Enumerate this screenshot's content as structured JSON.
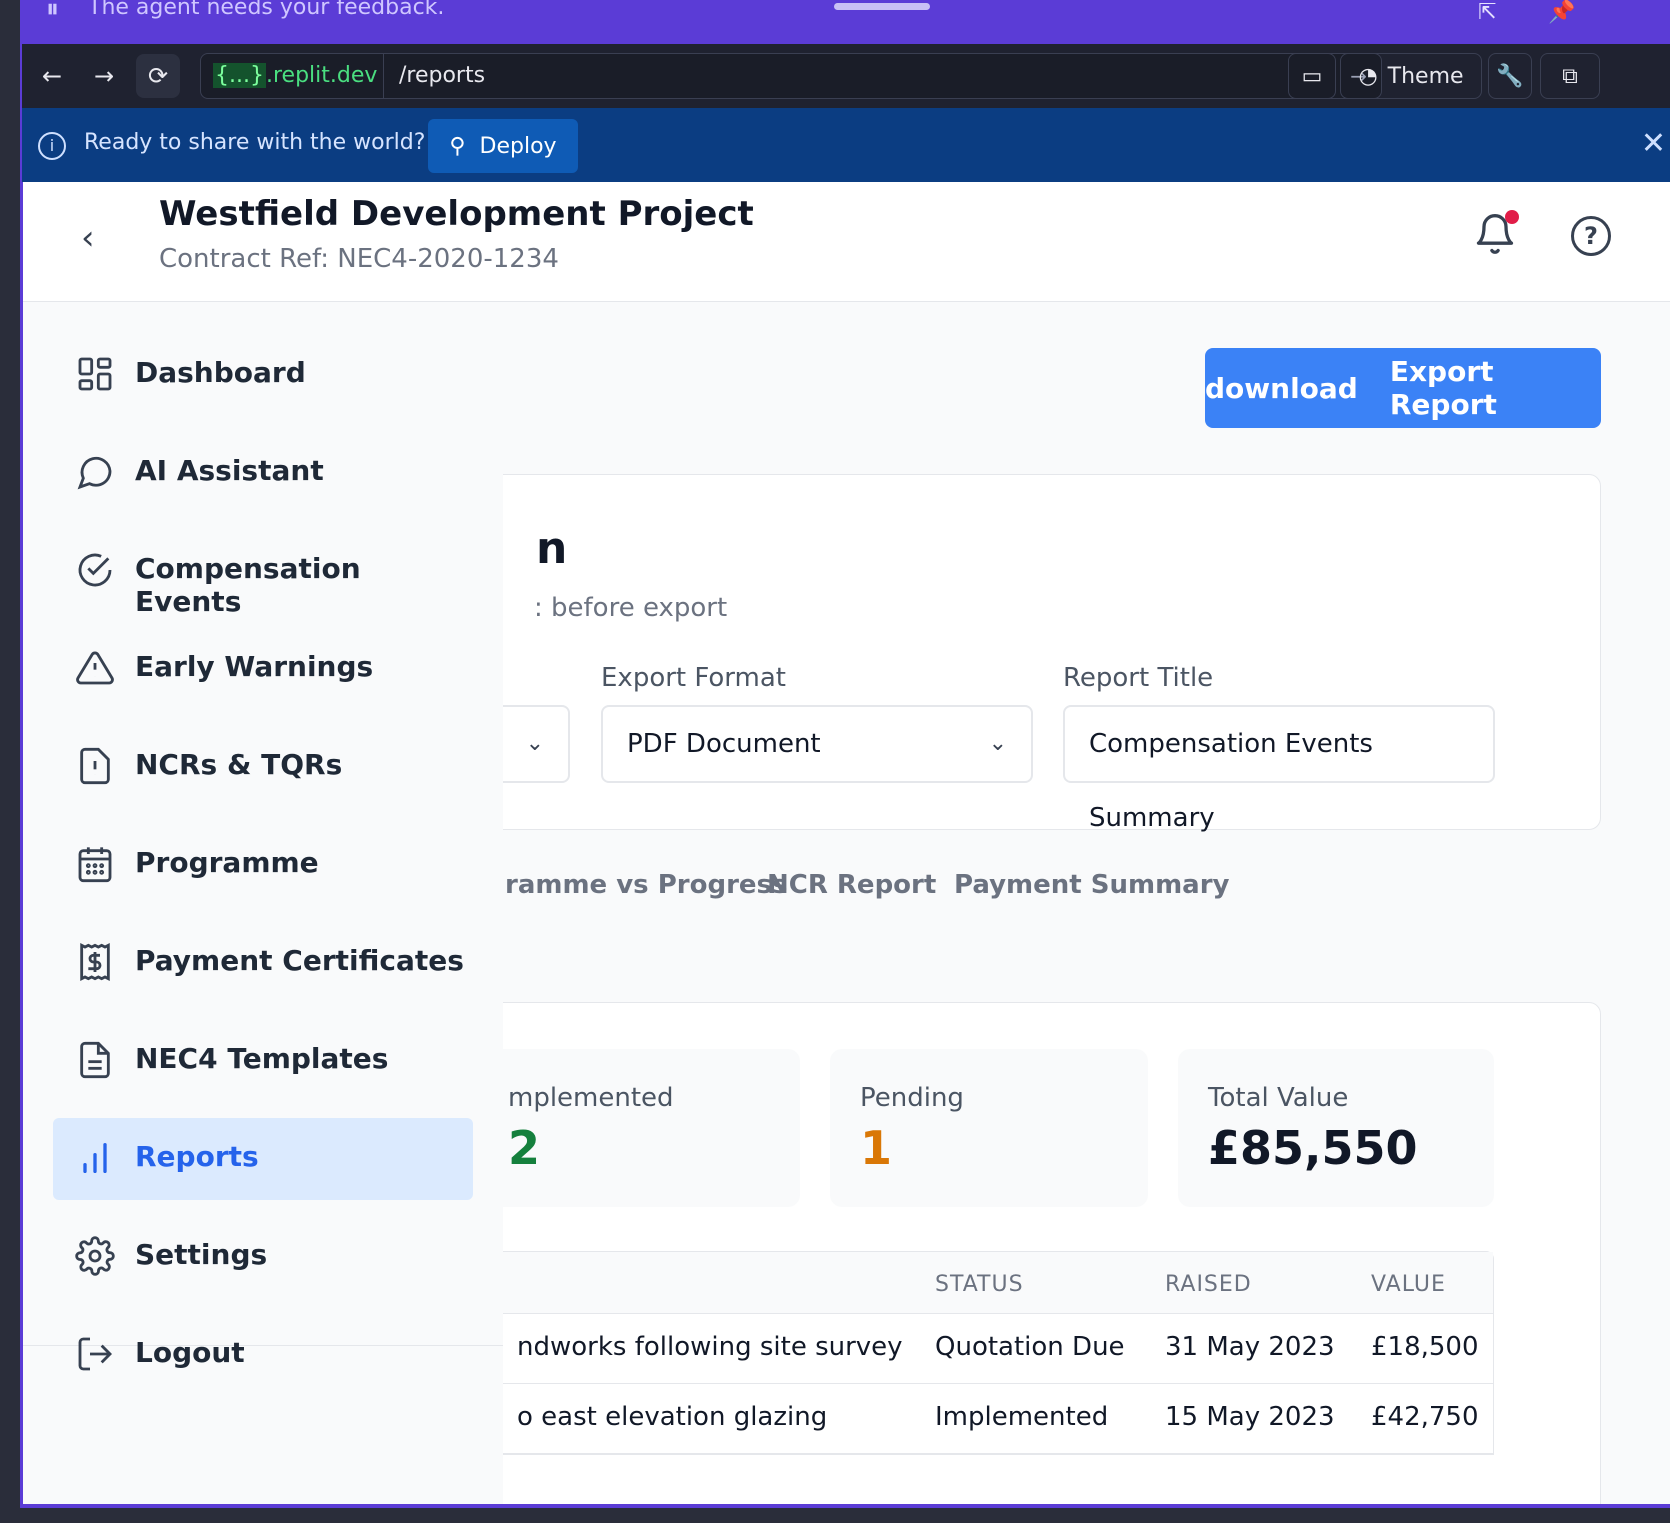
{
  "agent_bar": {
    "message": "The agent needs your feedback."
  },
  "browser": {
    "host_brace": "{...}",
    "host_domain": ".replit.dev",
    "path": "/reports",
    "theme_label": "Theme"
  },
  "deploy_banner": {
    "text": "Ready to share with the world?",
    "button_label": "Deploy"
  },
  "header": {
    "title": "Westfield Development Project",
    "contract_ref": "Contract Ref: NEC4-2020-1234"
  },
  "export_button": {
    "icon_text": "download",
    "label": "Export Report"
  },
  "config_card": {
    "title_fragment": "n",
    "subtitle_fragment": ": before export",
    "export_format_label": "Export Format",
    "export_format_value": "PDF Document",
    "report_title_label": "Report Title",
    "report_title_value": "Compensation Events Summary"
  },
  "tabs": [
    "ramme vs Progress",
    "NCR Report",
    "Payment Summary"
  ],
  "stats": [
    {
      "label": "mplemented",
      "value": "2",
      "color": "#15803d"
    },
    {
      "label": "Pending",
      "value": "1",
      "color": "#d97706"
    },
    {
      "label": "Total Value",
      "value": "£85,550",
      "color": "#111827"
    }
  ],
  "table": {
    "headers": {
      "status": "STATUS",
      "raised": "RAISED",
      "value": "VALUE"
    },
    "rows": [
      {
        "title": "ndworks following site survey",
        "status": "Quotation Due",
        "raised": "31 May 2023",
        "value": "£18,500"
      },
      {
        "title": "o east elevation glazing",
        "status": "Implemented",
        "raised": "15 May 2023",
        "value": "£42,750"
      }
    ]
  },
  "sidebar": {
    "items": [
      {
        "label": "Dashboard",
        "icon": "dashboard-icon"
      },
      {
        "label": "AI Assistant",
        "icon": "chat-icon"
      },
      {
        "label": "Compensation Events",
        "icon": "check-circle-icon"
      },
      {
        "label": "Early Warnings",
        "icon": "warning-icon"
      },
      {
        "label": "NCRs & TQRs",
        "icon": "file-alert-icon"
      },
      {
        "label": "Programme",
        "icon": "calendar-icon"
      },
      {
        "label": "Payment Certificates",
        "icon": "receipt-icon"
      },
      {
        "label": "NEC4 Templates",
        "icon": "document-icon"
      },
      {
        "label": "Reports",
        "icon": "bar-chart-icon",
        "active": true
      },
      {
        "label": "Settings",
        "icon": "gear-icon"
      },
      {
        "label": "Logout",
        "icon": "logout-icon"
      }
    ]
  },
  "colors": {
    "accent": "#3b82f6",
    "agent_bar": "#5b3cd6",
    "deploy_banner": "#0b3d82",
    "active_nav": "#dbeafe"
  }
}
